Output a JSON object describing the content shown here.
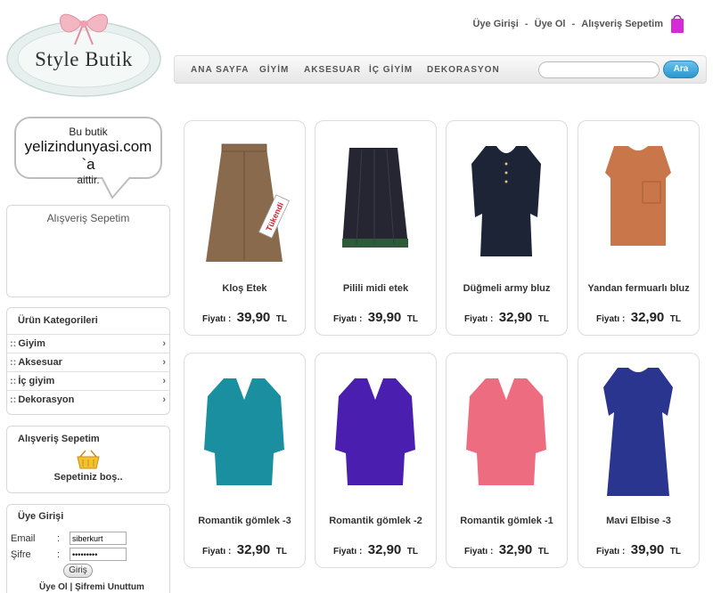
{
  "logo": {
    "text": "Style Butik"
  },
  "top_links": {
    "login": "Üye Girişi",
    "register": "Üye Ol",
    "cart": "Alışveriş Sepetim",
    "separator": "-"
  },
  "nav": {
    "items": [
      "ANA SAYFA",
      "GİYİM",
      "AKSESUAR",
      "İÇ GİYİM",
      "DEKORASYON"
    ],
    "search_placeholder": "",
    "search_button": "Ara"
  },
  "bubble": {
    "line1": "Bu butik",
    "line2": "yelizindunyasi.com `a",
    "line3": "aittir."
  },
  "cart_top": {
    "title": "Alışveriş Sepetim"
  },
  "categories": {
    "title": "Ürün Kategorileri",
    "items": [
      {
        "dots": "::",
        "label": "Giyim",
        "arrow": "›"
      },
      {
        "dots": "::",
        "label": "Aksesuar",
        "arrow": "›"
      },
      {
        "dots": "::",
        "label": "İç giyim",
        "arrow": "›"
      },
      {
        "dots": "::",
        "label": "Dekorasyon",
        "arrow": "›"
      }
    ]
  },
  "cart_box": {
    "title": "Alışveriş Sepetim",
    "empty": "Sepetiniz boş.."
  },
  "login": {
    "title": "Üye Girişi",
    "email_label": "Email",
    "email_value": "siberkurt",
    "password_label": "Şifre",
    "password_value": "•••••••••",
    "colon": ":",
    "button": "Giriş",
    "register_link": "Üye Ol",
    "link_sep": "|",
    "forgot_link": "Şifremi Unuttum"
  },
  "products": [
    {
      "name": "Kloş Etek",
      "price_label": "Fiyatı :",
      "price": "39,90",
      "currency": "TL",
      "sold_out": "Tükendi",
      "color": "#8a6a4c"
    },
    {
      "name": "Pilili midi etek",
      "price_label": "Fiyatı :",
      "price": "39,90",
      "currency": "TL",
      "color": "#262633"
    },
    {
      "name": "Düğmeli army bluz",
      "price_label": "Fiyatı :",
      "price": "32,90",
      "currency": "TL",
      "color": "#1c2436"
    },
    {
      "name": "Yandan fermuarlı bluz",
      "price_label": "Fiyatı :",
      "price": "32,90",
      "currency": "TL",
      "color": "#c9774a"
    },
    {
      "name": "Romantik gömlek -3",
      "price_label": "Fiyatı :",
      "price": "32,90",
      "currency": "TL",
      "color": "#1a8fa0"
    },
    {
      "name": "Romantik gömlek -2",
      "price_label": "Fiyatı :",
      "price": "32,90",
      "currency": "TL",
      "color": "#4a1fb0"
    },
    {
      "name": "Romantik gömlek -1",
      "price_label": "Fiyatı :",
      "price": "32,90",
      "currency": "TL",
      "color": "#ee6c80"
    },
    {
      "name": "Mavi Elbise -3",
      "price_label": "Fiyatı :",
      "price": "39,90",
      "currency": "TL",
      "color": "#2a3590"
    }
  ]
}
